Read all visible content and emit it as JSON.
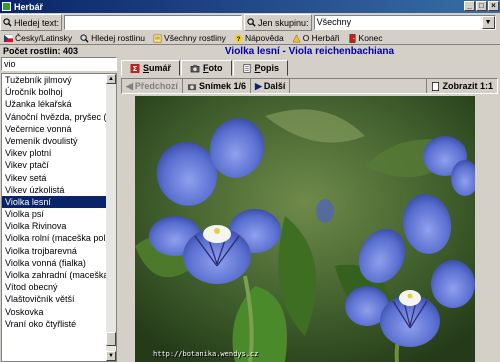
{
  "window": {
    "title": "Herbář",
    "controls": [
      "_",
      "□",
      "×"
    ]
  },
  "search": {
    "button_label": "Hledej text:",
    "value": "",
    "group_button_label": "Jen skupinu:",
    "group_value": "Všechny"
  },
  "toolbar": {
    "items": [
      {
        "label": "Česky/Latinsky",
        "icon": "flag-icon"
      },
      {
        "label": "Hledej rostlinu",
        "icon": "search-icon"
      },
      {
        "label": "Všechny rostliny",
        "icon": "list-icon"
      },
      {
        "label": "Nápověda",
        "icon": "help-icon"
      },
      {
        "label": "O Herbáři",
        "icon": "info-icon"
      },
      {
        "label": "Konec",
        "icon": "exit-icon"
      }
    ]
  },
  "left": {
    "count_label": "Počet rostlin: 403",
    "filter_value": "vio",
    "items": [
      "Tužebník jilmový",
      "Úročník bolhoj",
      "Užanka lékařská",
      "Vánoční hvězda, pryšec (",
      "Večernice vonná",
      "Vemeník dvoulistý",
      "Vikev plotní",
      "Vikev ptačí",
      "Vikev setá",
      "Vikev úzkolistá",
      "Violka lesní",
      "Violka psí",
      "Violka Rivinova",
      "Violka rolní (maceška pol",
      "Violka trojbarevná",
      "Violka vonná (fialka)",
      "Violka zahradní (maceška",
      "Vítod obecný",
      "Vlaštovičník větší",
      "Voskovka",
      "Vraní  oko čtyřlisté"
    ],
    "selected_index": 10
  },
  "right": {
    "plant_title": "Violka lesní - Viola reichenbachiana",
    "tabs": [
      {
        "label": "Sumář",
        "key": "S"
      },
      {
        "label": "Foto",
        "key": "F"
      },
      {
        "label": "Popis",
        "key": "P"
      }
    ],
    "active_tab": 1,
    "nav": {
      "prev_label": "Předchozí",
      "counter_label": "Snímek 1/6",
      "next_label": "Další",
      "zoom_label": "Zobrazit 1:1"
    },
    "photo_url": "http://botanika.wendys.cz"
  },
  "colors": {
    "titlebar": "#0a246a",
    "selection": "#0a246a",
    "plant_title": "#0000aa",
    "flower": "#5a6fd0"
  }
}
